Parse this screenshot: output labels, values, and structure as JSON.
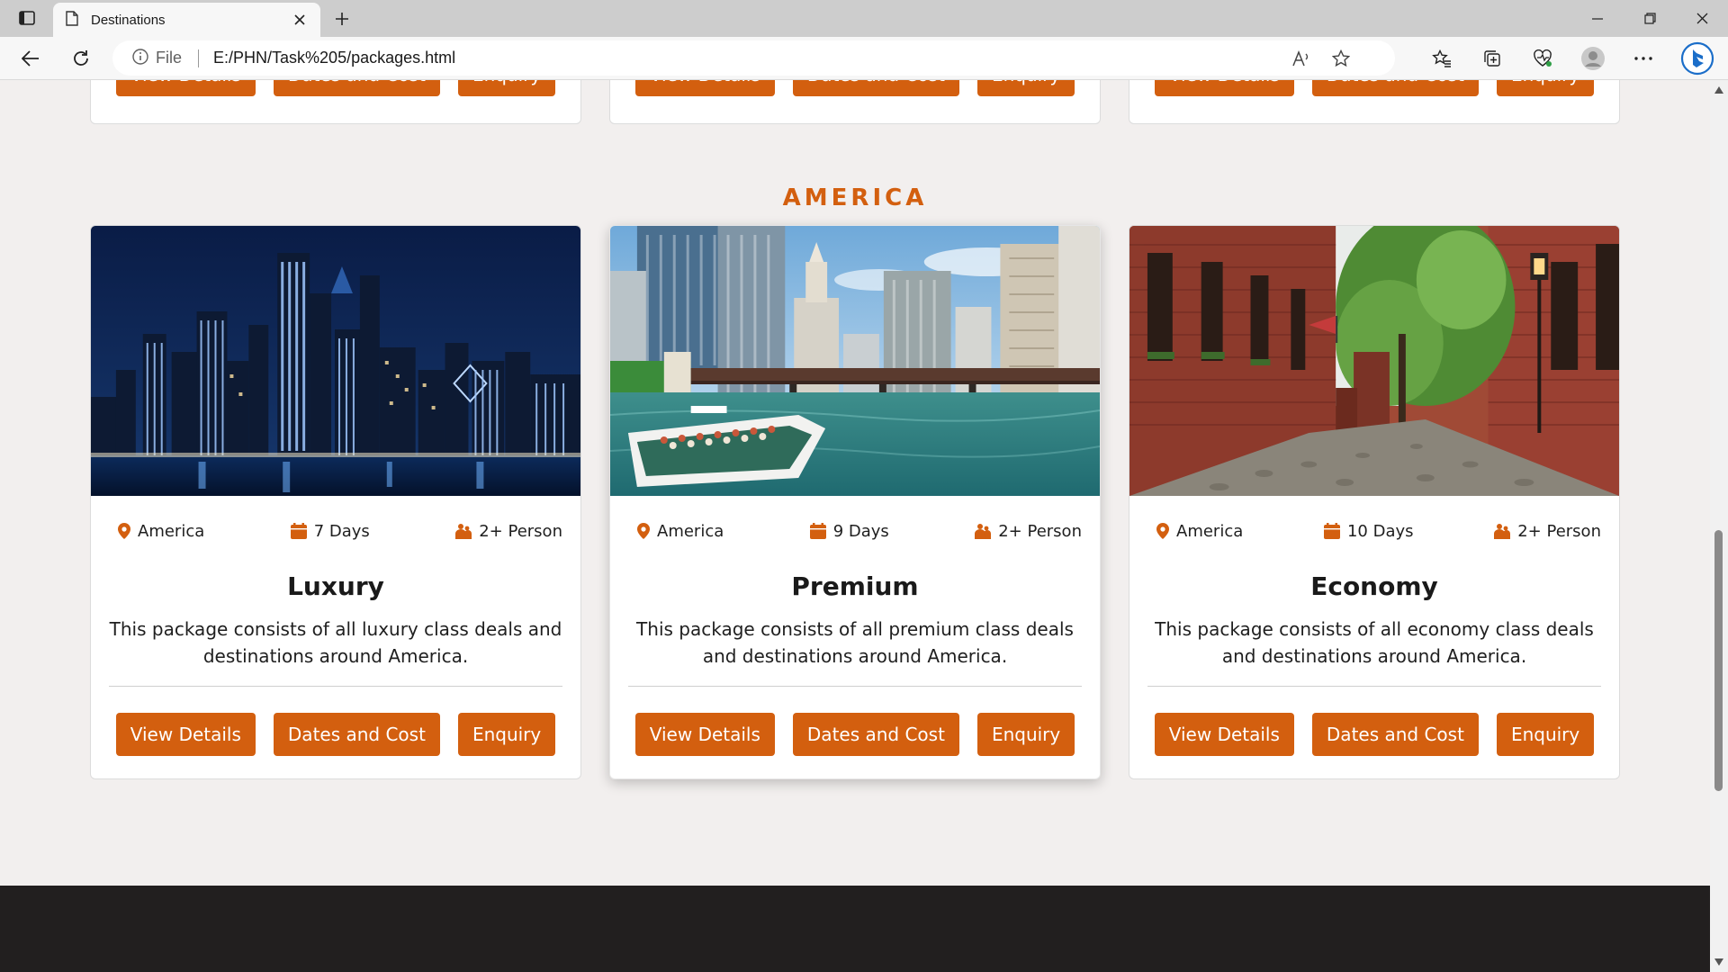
{
  "browser": {
    "tab_title": "Destinations",
    "address_info": "File",
    "address_url": "E:/PHN/Task%205/packages.html"
  },
  "top_row": {
    "buttons": [
      "View Details",
      "Dates and Cost",
      "Enquiry"
    ]
  },
  "section": {
    "title": "AMERICA"
  },
  "cards": [
    {
      "location": "America",
      "duration": "7 Days",
      "persons": "2+ Person",
      "title": "Luxury",
      "description": "This package consists of all luxury class deals and destinations around America.",
      "buttons": [
        "View Details",
        "Dates and Cost",
        "Enquiry"
      ]
    },
    {
      "location": "America",
      "duration": "9 Days",
      "persons": "2+ Person",
      "title": "Premium",
      "description": "This package consists of all premium class deals and destinations around America.",
      "buttons": [
        "View Details",
        "Dates and Cost",
        "Enquiry"
      ]
    },
    {
      "location": "America",
      "duration": "10 Days",
      "persons": "2+ Person",
      "title": "Economy",
      "description": "This package consists of all economy class deals and destinations around America.",
      "buttons": [
        "View Details",
        "Dates and Cost",
        "Enquiry"
      ]
    }
  ],
  "colors": {
    "accent": "#d35f0f",
    "page_background": "#f2efee",
    "footer": "#221f1f"
  },
  "icons": {
    "location": "map-pin-icon",
    "duration": "calendar-icon",
    "persons": "users-icon"
  }
}
